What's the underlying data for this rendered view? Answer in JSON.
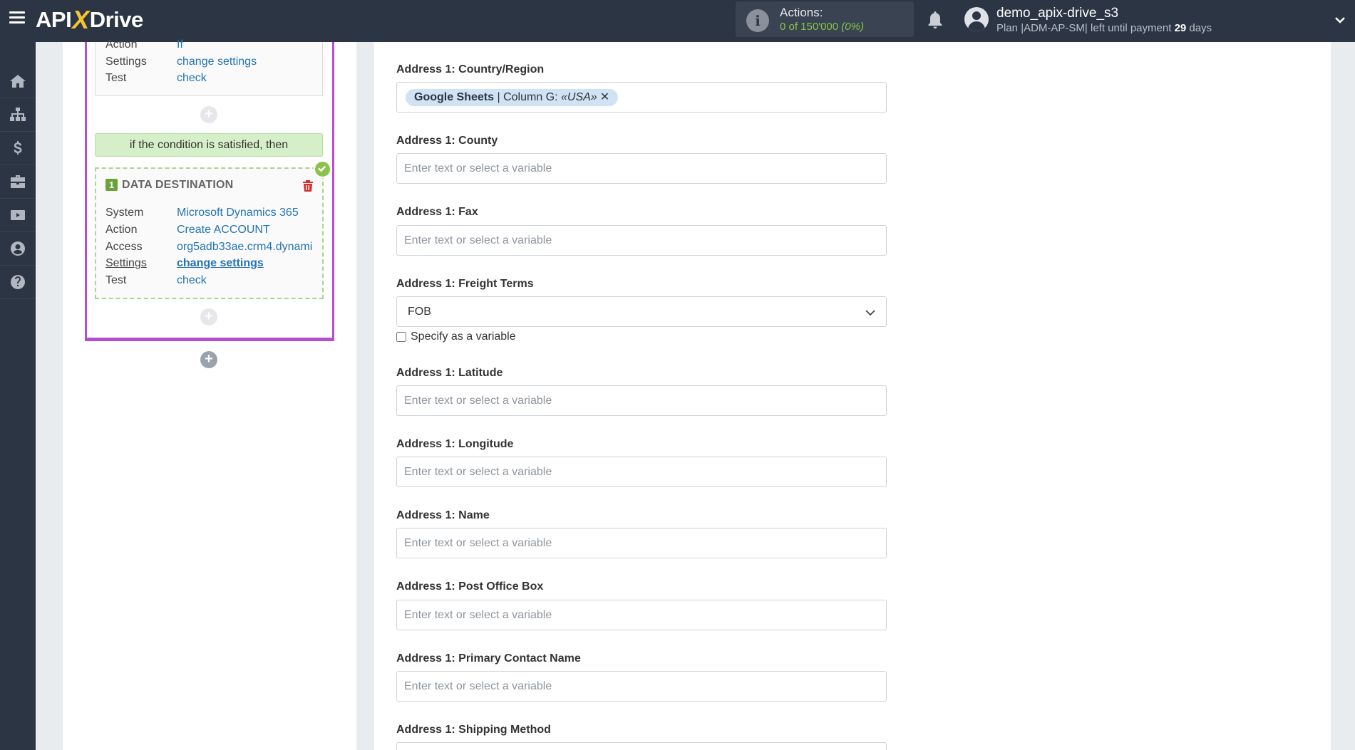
{
  "app": {
    "logo_left": "API",
    "logo_x": "X",
    "logo_right": "Drive"
  },
  "header": {
    "actions_label": "Actions:",
    "actions_count": "0 of 150'000",
    "actions_percent": "(0%)",
    "user_name": "demo_apix-drive_s3",
    "plan_prefix": "Plan |ADM-AP-SM| left until payment",
    "plan_days": "29",
    "plan_suffix": "days"
  },
  "sidebar": {
    "items": [
      "home-icon",
      "sitemap-icon",
      "dollar-icon",
      "briefcase-icon",
      "video-icon",
      "user-icon",
      "help-icon"
    ]
  },
  "flow": {
    "condition_rows": [
      {
        "key": "Action",
        "value": "If"
      },
      {
        "key": "Settings",
        "value": "change settings"
      },
      {
        "key": "Test",
        "value": "check"
      }
    ],
    "condition_banner": "if the condition is satisfied, then",
    "destination": {
      "number": "1",
      "title": "DATA DESTINATION",
      "rows": [
        {
          "key": "System",
          "value": "Microsoft Dynamics 365"
        },
        {
          "key": "Action",
          "value": "Create ACCOUNT"
        },
        {
          "key": "Access",
          "value": "org5adb33ae.crm4.dynami"
        },
        {
          "key": "Settings",
          "value": "change settings"
        },
        {
          "key": "Test",
          "value": "check"
        }
      ]
    }
  },
  "form": {
    "placeholder": "Enter text or select a variable",
    "country_label": "Address 1: Country/Region",
    "country_tag": {
      "source": "Google Sheets",
      "column": "Column G:",
      "value": "«USA»",
      "remove": "✕"
    },
    "county_label": "Address 1: County",
    "fax_label": "Address 1: Fax",
    "freight_label": "Address 1: Freight Terms",
    "freight_value": "FOB",
    "specify_variable": "Specify as a variable",
    "latitude_label": "Address 1: Latitude",
    "longitude_label": "Address 1: Longitude",
    "name_label": "Address 1: Name",
    "pobox_label": "Address 1: Post Office Box",
    "contact_label": "Address 1: Primary Contact Name",
    "shipping_label": "Address 1: Shipping Method"
  },
  "colors": {
    "topbar": "#2b3544",
    "accent_purple": "#b44fd0",
    "link_blue": "#2474b5",
    "success_green": "#8bc34a"
  }
}
